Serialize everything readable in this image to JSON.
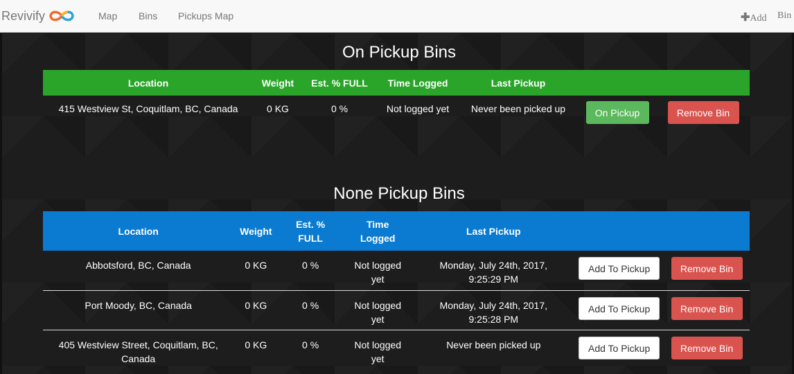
{
  "nav": {
    "brand": "Revivify",
    "links": [
      "Map",
      "Bins",
      "Pickups Map"
    ],
    "add_label": "Add",
    "bin_label": "Bin"
  },
  "colors": {
    "green_header": "#2aa52a",
    "blue_header": "#0a7bd0",
    "success": "#5cb85c",
    "danger": "#d9534f"
  },
  "on_pickup": {
    "title": "On Pickup Bins",
    "headers": [
      "Location",
      "Weight",
      "Est. % FULL",
      "Time Logged",
      "Last Pickup"
    ],
    "rows": [
      {
        "location": "415 Westview St, Coquitlam, BC, Canada",
        "weight": "0 KG",
        "full": "0 %",
        "time_logged": "Not logged yet",
        "last_pickup": "Never been picked up",
        "action": "On Pickup",
        "remove": "Remove Bin"
      }
    ]
  },
  "none_pickup": {
    "title": "None Pickup Bins",
    "headers": [
      "Location",
      "Weight",
      "Est. % FULL",
      "Time Logged",
      "Last Pickup"
    ],
    "rows": [
      {
        "location": "Abbotsford, BC, Canada",
        "weight": "0 KG",
        "full": "0 %",
        "time_logged": "Not logged yet",
        "last_pickup": "Monday, July 24th, 2017, 9:25:29 PM",
        "action": "Add To Pickup",
        "remove": "Remove Bin"
      },
      {
        "location": "Port Moody, BC, Canada",
        "weight": "0 KG",
        "full": "0 %",
        "time_logged": "Not logged yet",
        "last_pickup": "Monday, July 24th, 2017, 9:25:28 PM",
        "action": "Add To Pickup",
        "remove": "Remove Bin"
      },
      {
        "location": "405 Westview Street, Coquitlam, BC, Canada",
        "weight": "0 KG",
        "full": "0 %",
        "time_logged": "Not logged yet",
        "last_pickup": "Never been picked up",
        "action": "Add To Pickup",
        "remove": "Remove Bin"
      }
    ]
  }
}
